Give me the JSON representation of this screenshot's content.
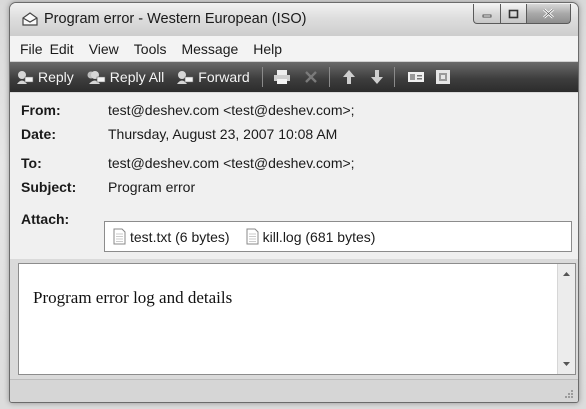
{
  "window": {
    "title": "Program error - Western European (ISO)"
  },
  "menu": [
    "File",
    "Edit",
    "View",
    "Tools",
    "Message",
    "Help"
  ],
  "toolbar": {
    "reply": "Reply",
    "reply_all": "Reply All",
    "forward": "Forward",
    "icons": [
      "print-icon",
      "delete-icon",
      "previous-icon",
      "next-icon",
      "addresses-icon",
      "inbox-icon"
    ]
  },
  "header": {
    "from_label": "From:",
    "from_value": "test@deshev.com <test@deshev.com>;",
    "date_label": "Date:",
    "date_value": "Thursday, August 23, 2007 10:08 AM",
    "to_label": "To:",
    "to_value": "test@deshev.com <test@deshev.com>;",
    "subject_label": "Subject:",
    "subject_value": "Program error",
    "attach_label": "Attach:",
    "attachments": [
      "test.txt (6 bytes)",
      "kill.log (681 bytes)"
    ]
  },
  "body": {
    "text": "Program error log and details"
  },
  "colors": {
    "toolbar_bg": "#3e3e3e",
    "menubar_bg": "#f3f3f3",
    "header_bg": "#f0f0f0"
  }
}
